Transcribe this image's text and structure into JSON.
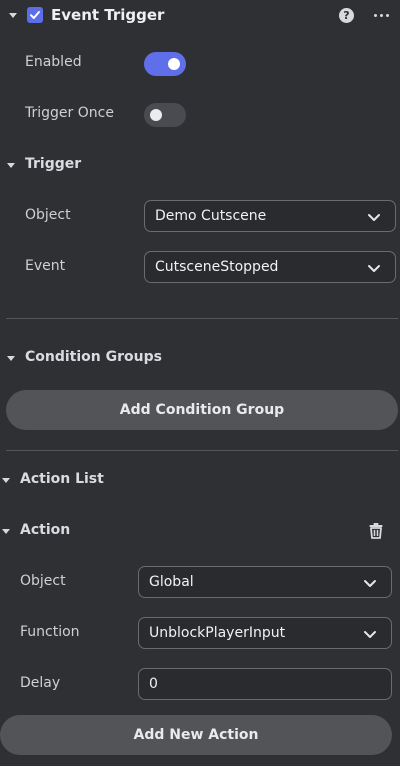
{
  "header": {
    "title": "Event Trigger",
    "enabled_checked": true,
    "help_glyph": "?",
    "help_icon": "help-icon",
    "more_icon": "more-icon"
  },
  "settings": {
    "enabled_label": "Enabled",
    "enabled_value": true,
    "trigger_once_label": "Trigger Once",
    "trigger_once_value": false
  },
  "trigger": {
    "section_label": "Trigger",
    "object_label": "Object",
    "object_value": "Demo Cutscene",
    "event_label": "Event",
    "event_value": "CutsceneStopped"
  },
  "conditions": {
    "section_label": "Condition Groups",
    "add_button_label": "Add Condition Group"
  },
  "actions": {
    "list_label": "Action List",
    "action_label": "Action",
    "delete_icon": "trash-icon",
    "object_label": "Object",
    "object_value": "Global",
    "function_label": "Function",
    "function_value": "UnblockPlayerInput",
    "delay_label": "Delay",
    "delay_value": "0",
    "add_button_label": "Add New Action"
  },
  "colors": {
    "background": "#2f3034",
    "accent": "#5f6fea",
    "button": "#535458",
    "field_border": "#6a6b70"
  }
}
